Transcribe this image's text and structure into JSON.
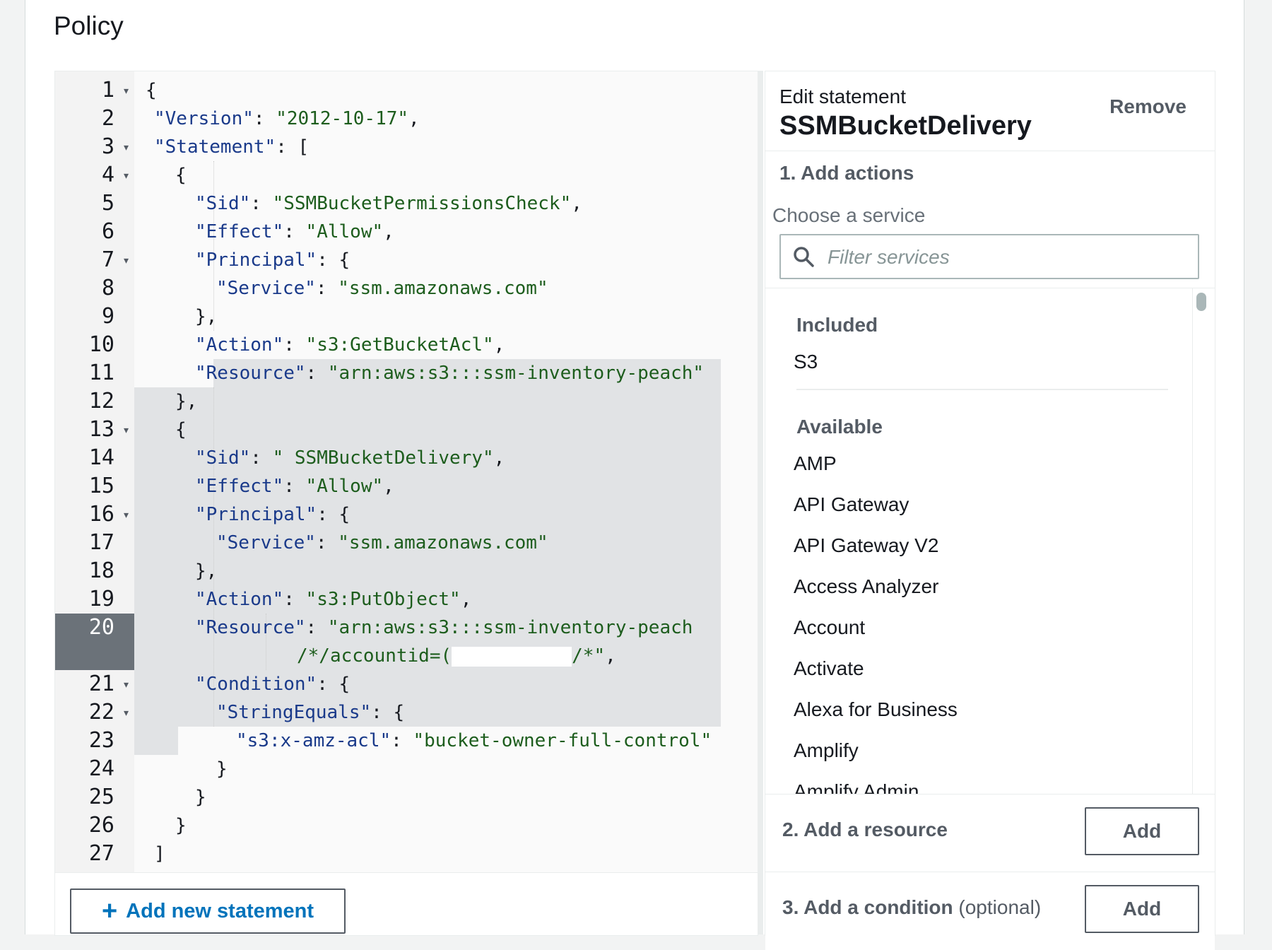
{
  "policy": {
    "title": "Policy"
  },
  "editor": {
    "line_numbers": [
      "1",
      "2",
      "3",
      "4",
      "5",
      "6",
      "7",
      "8",
      "9",
      "10",
      "11",
      "12",
      "13",
      "14",
      "15",
      "16",
      "17",
      "18",
      "19",
      "20",
      "21",
      "22",
      "23",
      "24",
      "25",
      "26",
      "27"
    ],
    "active_line": "20",
    "code": {
      "l1": "{",
      "l2_key": "\"Version\"",
      "l2_sep": ": ",
      "l2_val": "\"2012-10-17\"",
      "l2_end": ",",
      "l3_key": "\"Statement\"",
      "l3_sep": ": [",
      "l4": "{",
      "l5_key": "\"Sid\"",
      "l5_sep": ": ",
      "l5_val": "\"SSMBucketPermissionsCheck\"",
      "l5_end": ",",
      "l6_key": "\"Effect\"",
      "l6_sep": ": ",
      "l6_val": "\"Allow\"",
      "l6_end": ",",
      "l7_key": "\"Principal\"",
      "l7_sep": ": {",
      "l8_key": "\"Service\"",
      "l8_sep": ": ",
      "l8_val": "\"ssm.amazonaws.com\"",
      "l9": "},",
      "l10_key": "\"Action\"",
      "l10_sep": ": ",
      "l10_val": "\"s3:GetBucketAcl\"",
      "l10_end": ",",
      "l11_key": "\"Resource\"",
      "l11_sep": ": ",
      "l11_val": "\"arn:aws:s3:::ssm-inventory-peach\"",
      "l12": "},",
      "l13": "{",
      "l14_key": "\"Sid\"",
      "l14_sep": ": ",
      "l14_val": "\" SSMBucketDelivery\"",
      "l14_end": ",",
      "l15_key": "\"Effect\"",
      "l15_sep": ": ",
      "l15_val": "\"Allow\"",
      "l15_end": ",",
      "l16_key": "\"Principal\"",
      "l16_sep": ": {",
      "l17_key": "\"Service\"",
      "l17_sep": ": ",
      "l17_val": "\"ssm.amazonaws.com\"",
      "l18": "},",
      "l19_key": "\"Action\"",
      "l19_sep": ": ",
      "l19_val": "\"s3:PutObject\"",
      "l19_end": ",",
      "l20_key": "\"Resource\"",
      "l20_sep": ": ",
      "l20_val": "\"arn:aws:s3:::ssm-inventory-peach",
      "l20b_val": "/*/accountid=(",
      "l20b_val2": "/*\"",
      "l20b_end": ",",
      "l21_key": "\"Condition\"",
      "l21_sep": ": {",
      "l22_key": "\"StringEquals\"",
      "l22_sep": ": {",
      "l23_key": "\"s3:x-amz-acl\"",
      "l23_sep": ": ",
      "l23_val": "\"bucket-owner-full-control\"",
      "l24": "}",
      "l25": "}",
      "l26": "}",
      "l27": "]"
    },
    "add_statement_label": "Add new statement"
  },
  "side_panel": {
    "edit_label": "Edit statement",
    "statement_name": "SSMBucketDelivery",
    "remove_label": "Remove",
    "step1_label": "1. Add actions",
    "choose_service_label": "Choose a service",
    "filter_placeholder": "Filter services",
    "included_heading": "Included",
    "included": [
      "S3"
    ],
    "available_heading": "Available",
    "available": [
      "AMP",
      "API Gateway",
      "API Gateway V2",
      "Access Analyzer",
      "Account",
      "Activate",
      "Alexa for Business",
      "Amplify",
      "Amplify Admin"
    ],
    "step2_label": "2. Add a resource",
    "step2_button": "Add",
    "step3_label": "3. Add a condition",
    "step3_optional": "(optional)",
    "step3_button": "Add"
  },
  "colors": {
    "link_blue": "#0073bb",
    "key_blue": "#1a3a8a",
    "string_green": "#1d5d1d",
    "active_gutter": "#6b7279"
  }
}
